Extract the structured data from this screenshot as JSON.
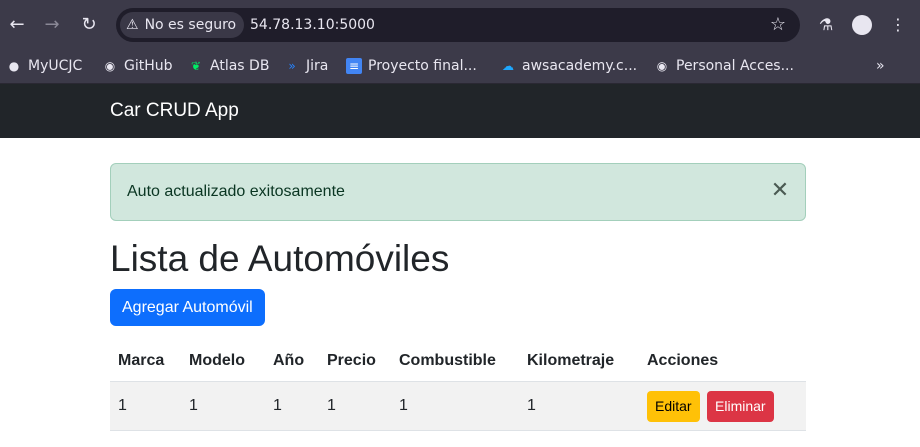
{
  "browser": {
    "security_label": "No es seguro",
    "url": "54.78.13.10:5000",
    "bookmarks": [
      {
        "label": "MyUCJC"
      },
      {
        "label": "GitHub"
      },
      {
        "label": "Atlas DB"
      },
      {
        "label": "Jira"
      },
      {
        "label": "Proyecto final..."
      },
      {
        "label": "awsacademy.c..."
      },
      {
        "label": "Personal Acces..."
      }
    ],
    "more_bookmarks": "»"
  },
  "navbar": {
    "brand": "Car CRUD App"
  },
  "alert": {
    "message": "Auto actualizado exitosamente",
    "close": "✕"
  },
  "page": {
    "title": "Lista de Automóviles",
    "add_button": "Agregar Automóvil"
  },
  "table": {
    "headers": [
      "Marca",
      "Modelo",
      "Año",
      "Precio",
      "Combustible",
      "Kilometraje",
      "Acciones"
    ],
    "rows": [
      {
        "marca": "1",
        "modelo": "1",
        "anio": "1",
        "precio": "1",
        "combustible": "1",
        "kilometraje": "1",
        "edit_label": "Editar",
        "delete_label": "Eliminar"
      }
    ]
  },
  "colors": {
    "navbar": "#212529",
    "alert_bg": "#d1e7dd",
    "primary": "#0d6efd",
    "warning": "#ffc107",
    "danger": "#dc3545"
  }
}
